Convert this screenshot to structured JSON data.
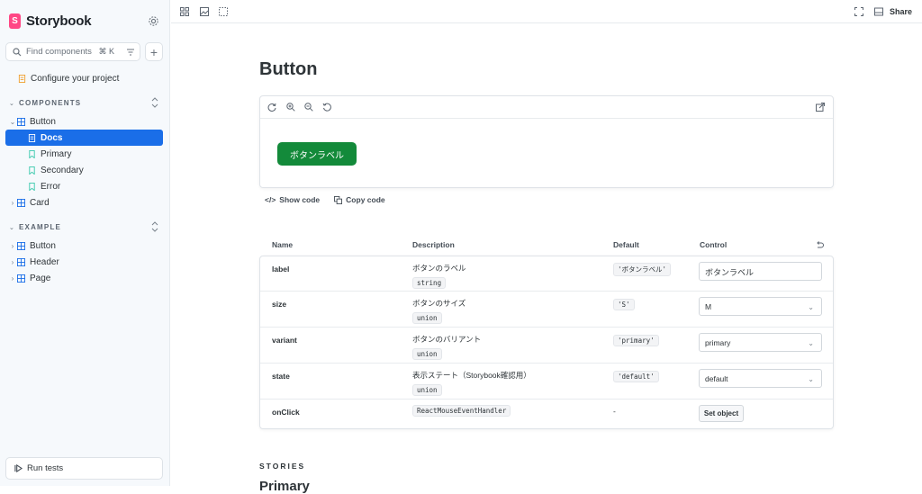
{
  "app": {
    "name": "Storybook"
  },
  "search": {
    "placeholder": "Find components",
    "shortcut": "⌘ K"
  },
  "sidebar": {
    "configure": "Configure your project",
    "sections": [
      {
        "label": "COMPONENTS"
      },
      {
        "label": "EXAMPLE"
      }
    ],
    "components": [
      {
        "label": "Button",
        "type": "component",
        "expanded": true
      },
      {
        "label": "Docs",
        "type": "docs",
        "selected": true
      },
      {
        "label": "Primary",
        "type": "story"
      },
      {
        "label": "Secondary",
        "type": "story"
      },
      {
        "label": "Error",
        "type": "story"
      },
      {
        "label": "Card",
        "type": "component",
        "expanded": false
      }
    ],
    "example": [
      {
        "label": "Button",
        "type": "component"
      },
      {
        "label": "Header",
        "type": "component"
      },
      {
        "label": "Page",
        "type": "component"
      }
    ],
    "run_tests": "Run tests"
  },
  "toolbar": {
    "share": "Share",
    "icons": [
      "grid-icon",
      "image-icon",
      "outline-icon",
      "fullscreen-icon",
      "panel-icon"
    ]
  },
  "docs": {
    "title": "Button",
    "preview_button": "ボタンラベル",
    "show_code": "Show code",
    "copy_code": "Copy code",
    "table_headers": {
      "name": "Name",
      "description": "Description",
      "default": "Default",
      "control": "Control"
    },
    "rows": [
      {
        "name": "label",
        "desc": "ボタンのラベル",
        "type": "string",
        "default": "'ボタンラベル'",
        "control": "ボタンラベル",
        "control_type": "textarea"
      },
      {
        "name": "size",
        "desc": "ボタンのサイズ",
        "type": "union",
        "default": "'S'",
        "control": "M",
        "control_type": "select"
      },
      {
        "name": "variant",
        "desc": "ボタンのバリアント",
        "type": "union",
        "default": "'primary'",
        "control": "primary",
        "control_type": "select"
      },
      {
        "name": "state",
        "desc": "表示ステート（Storybook確認用）",
        "type": "union",
        "default": "'default'",
        "control": "default",
        "control_type": "select"
      },
      {
        "name": "onClick",
        "desc": "",
        "type": "ReactMouseEventHandler",
        "default": "-",
        "control": "Set object",
        "control_type": "button"
      }
    ],
    "stories_label": "STORIES",
    "first_story": "Primary"
  },
  "colors": {
    "accent": "#1a6ee8",
    "brand": "#ff4785",
    "preview_button": "#138a3a"
  }
}
